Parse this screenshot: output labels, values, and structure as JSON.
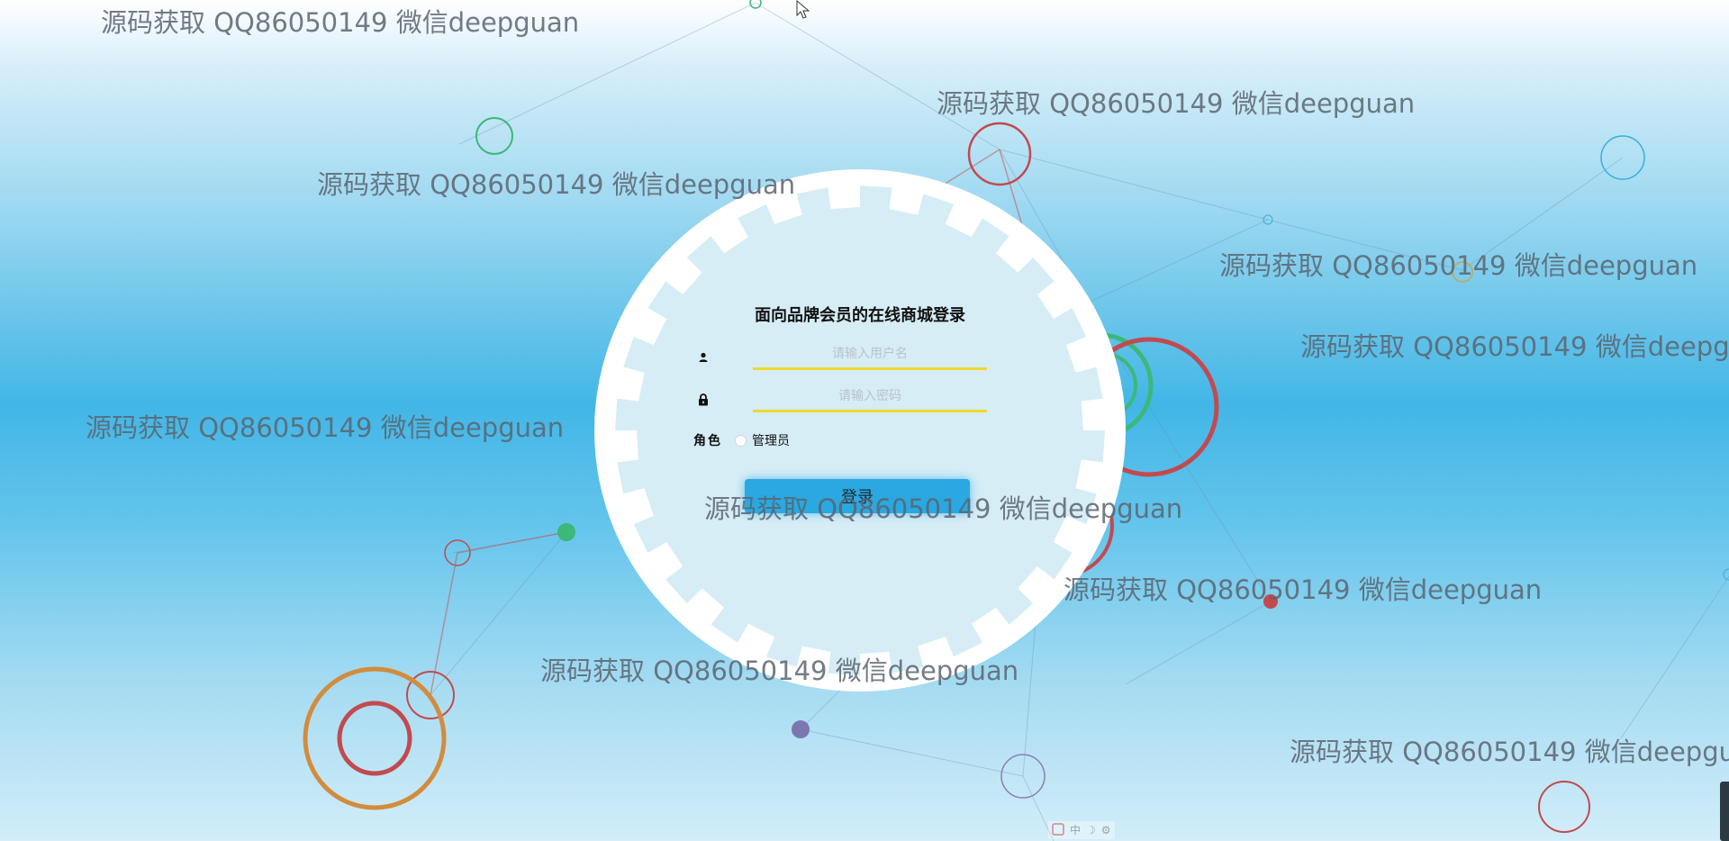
{
  "watermark_text": "源码获取 QQ86050149 微信deepguan",
  "login": {
    "title": "面向品牌会员的在线商城登录",
    "username_placeholder": "请输入用户名",
    "password_placeholder": "请输入密码",
    "role_label": "角色",
    "role_option": "管理员",
    "submit_label": "登录"
  },
  "toolbar": {
    "items": [
      "中",
      "☽",
      "⚙"
    ]
  },
  "colors": {
    "accent": "#2aa8e2",
    "input_underline": "#f0d92a"
  }
}
